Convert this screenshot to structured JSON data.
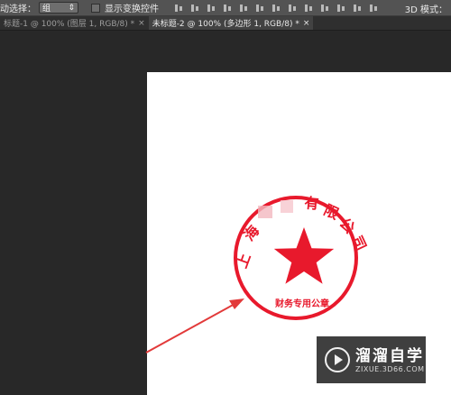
{
  "options_bar": {
    "auto_select_label": "动选择：",
    "auto_select_value": "组",
    "show_transform_label": "显示变换控件",
    "mode_3d_label": "3D 模式："
  },
  "tabs": [
    {
      "label": "标题-1 @ 100% (图层 1, RGB/8) *",
      "close": "×",
      "active": false
    },
    {
      "label": "未标题-2 @ 100% (多边形 1, RGB/8) *",
      "close": "×",
      "active": true
    }
  ],
  "stamp": {
    "top_text_chars": [
      "上",
      "海",
      "",
      "",
      "有",
      "限",
      "公",
      "司"
    ],
    "bottom_text": "财务专用公章",
    "color": "#e8192c"
  },
  "watermark": {
    "brand": "溜溜自学",
    "url": "ZIXUE.3D66.COM"
  },
  "colors": {
    "toolbar_bg": "#535353",
    "workspace_bg": "#282828",
    "arrow": "#e23a3a"
  }
}
